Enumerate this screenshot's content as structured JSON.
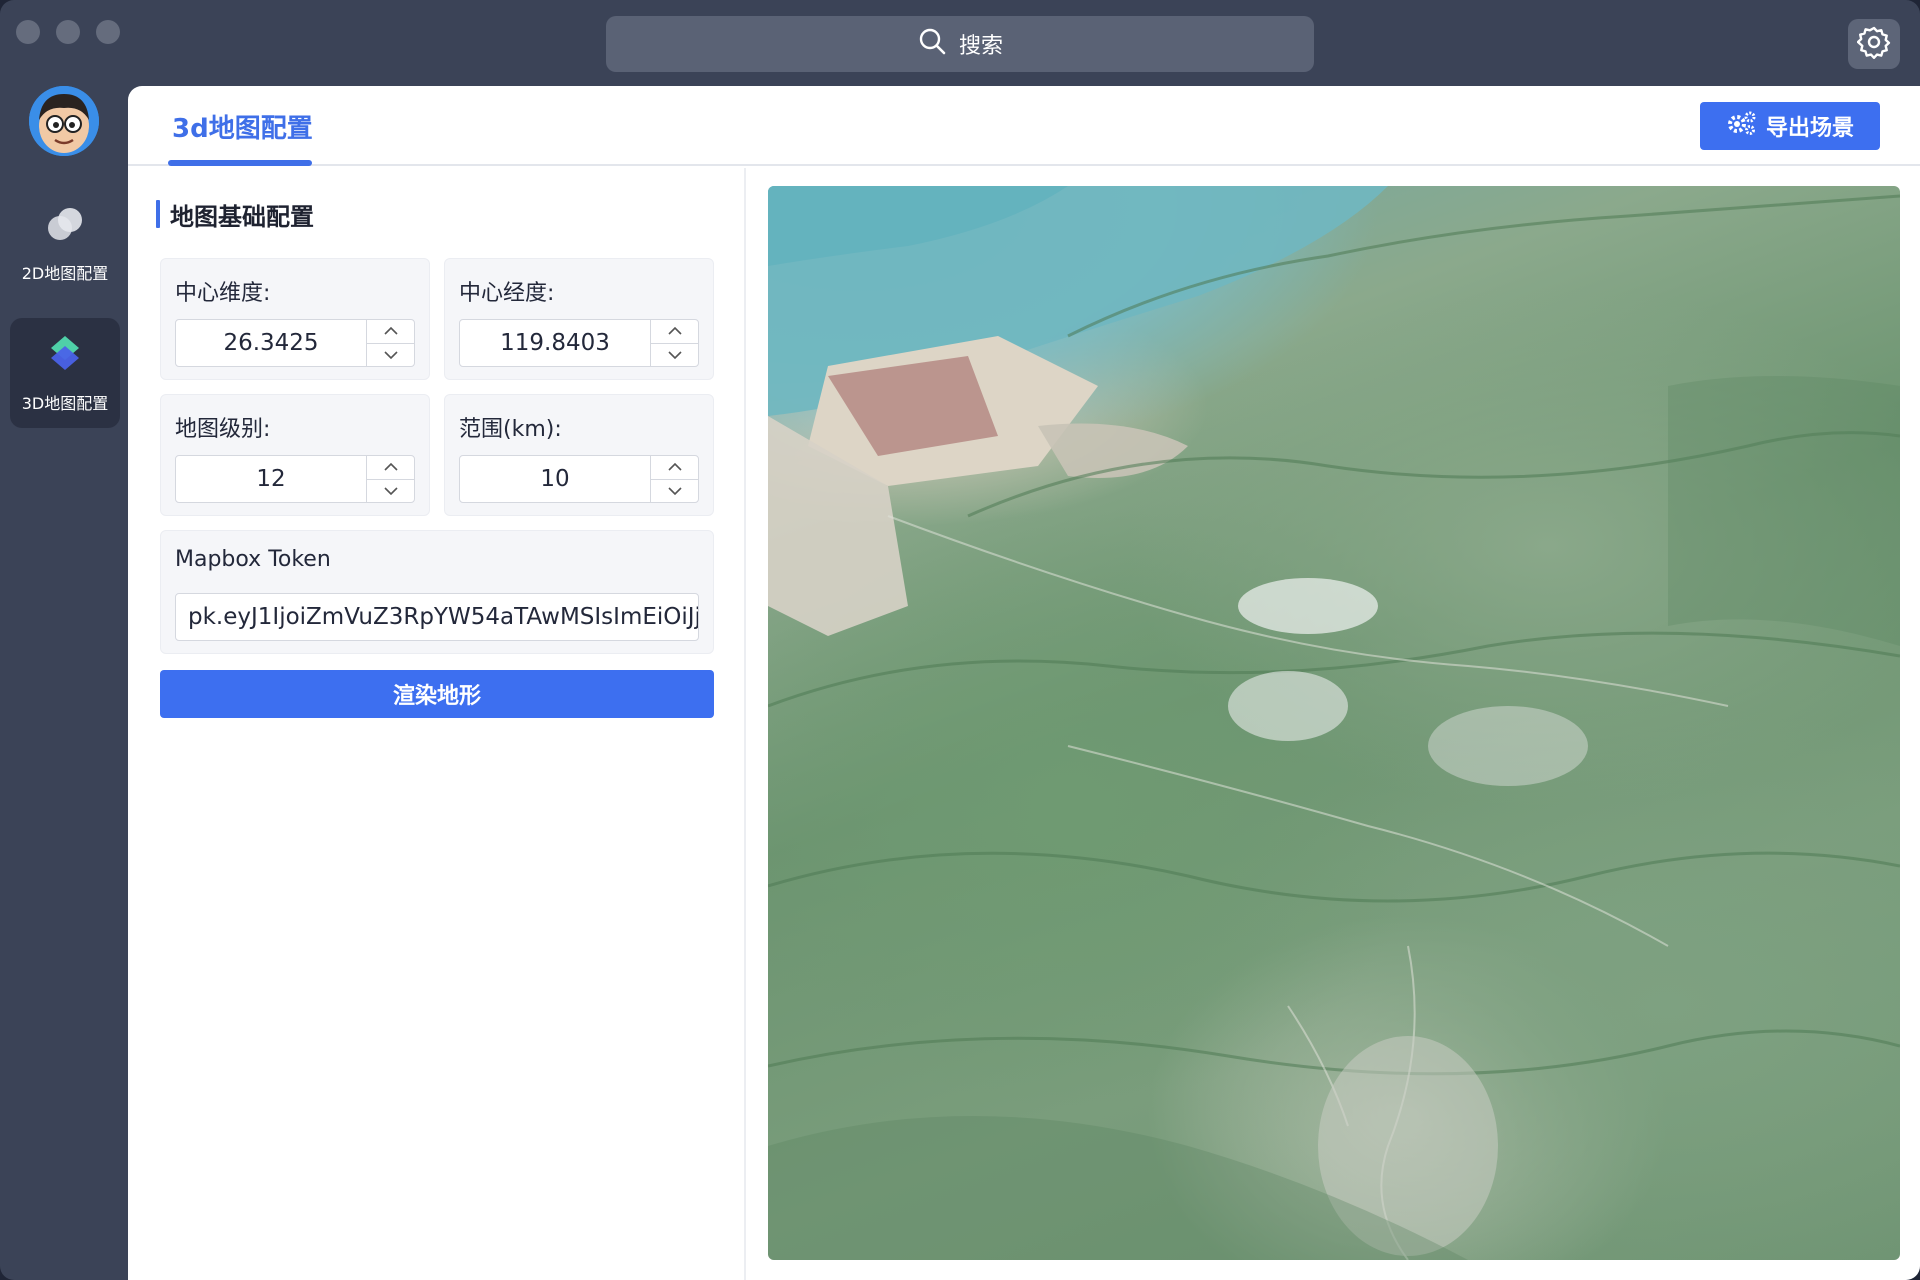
{
  "titlebar": {
    "search_label": "搜索"
  },
  "sidebar": {
    "items": [
      {
        "label": "2D地图配置",
        "icon": "circles-icon",
        "active": false
      },
      {
        "label": "3D地图配置",
        "icon": "layers-icon",
        "active": true
      }
    ]
  },
  "header": {
    "tab_label": "3d地图配置",
    "export_label": "导出场景"
  },
  "form": {
    "section_title": "地图基础配置",
    "center_lat": {
      "label": "中心维度:",
      "value": "26.3425"
    },
    "center_lng": {
      "label": "中心经度:",
      "value": "119.8403"
    },
    "zoom": {
      "label": "地图级别:",
      "value": "12"
    },
    "range": {
      "label": "范围(km):",
      "value": "10"
    },
    "token": {
      "label": "Mapbox Token",
      "value": "pk.eyJ1IjoiZmVuZ3RpYW54aTAwMSIsImEiOiJj"
    },
    "render_label": "渲染地形"
  },
  "colors": {
    "accent": "#3d6ff0",
    "window_bg": "#3b4357",
    "sidebar_active": "#2b3143"
  }
}
